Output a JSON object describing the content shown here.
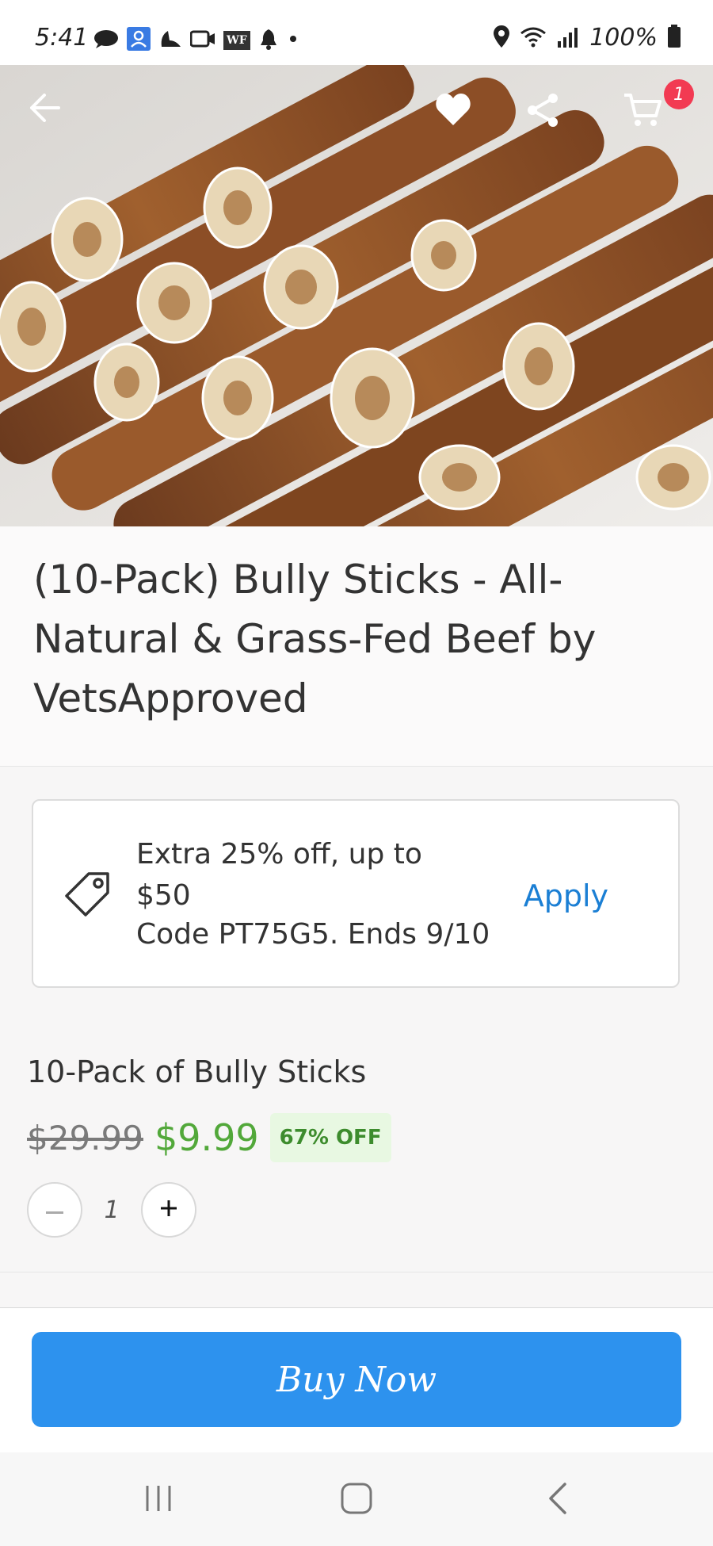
{
  "status_bar": {
    "time": "5:41",
    "battery": "100%",
    "notification_icons": [
      "chat-bubble-icon",
      "user-card-icon",
      "alert-icon",
      "video-icon",
      "wf-icon",
      "bell-icon",
      "dot-icon"
    ],
    "wf_label": "WF",
    "status_icons": [
      "location-icon",
      "wifi-icon",
      "signal-icon",
      "battery-icon"
    ]
  },
  "header": {
    "cart_count": "1"
  },
  "product": {
    "title": "(10-Pack) Bully Sticks - All-Natural & Grass-Fed Beef by VetsApproved"
  },
  "promo": {
    "line1": "Extra 25% off, up to $50",
    "line2": "Code PT75G5. Ends 9/10",
    "apply_label": "Apply"
  },
  "option": {
    "title": "10-Pack of Bully Sticks",
    "old_price": "$29.99",
    "new_price": "$9.99",
    "discount": "67% OFF",
    "quantity": "1"
  },
  "buy": {
    "label": "Buy Now"
  },
  "colors": {
    "accent": "#2d92ee",
    "apply": "#1b7fd4",
    "price": "#52a83a",
    "badge": "#f23a52"
  }
}
